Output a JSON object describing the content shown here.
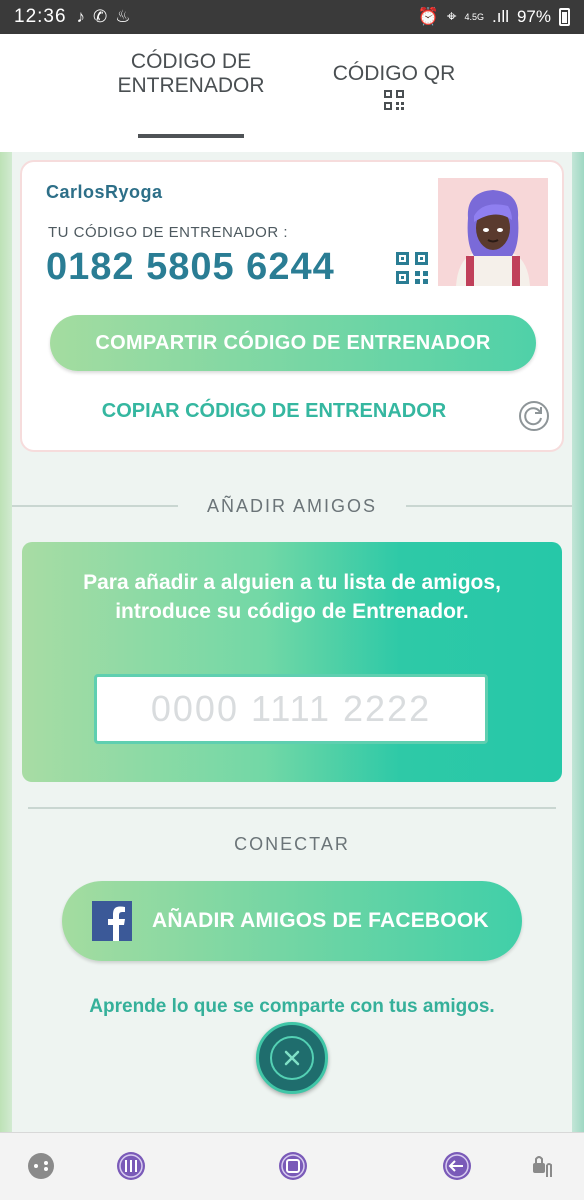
{
  "status_bar": {
    "time": "12:36",
    "network": "4.5G",
    "battery": "97%"
  },
  "tabs": [
    {
      "line1": "CÓDIGO DE",
      "line2": "ENTRENADOR",
      "selected": true
    },
    {
      "line1": "CÓDIGO QR",
      "selected": false
    }
  ],
  "trainer_card": {
    "name": "CarlosRyoga",
    "code_label": "TU CÓDIGO DE ENTRENADOR :",
    "code": "0182 5805 6244",
    "share_button": "COMPARTIR CÓDIGO DE ENTRENADOR",
    "copy_link": "COPIAR CÓDIGO DE ENTRENADOR"
  },
  "add_friends": {
    "section_title": "AÑADIR AMIGOS",
    "instructions": "Para añadir a alguien a tu lista de amigos, introduce su código de Entrenador.",
    "input_placeholder": "0000 1111 2222"
  },
  "connect": {
    "section_title": "CONECTAR",
    "facebook_button": "AÑADIR AMIGOS DE FACEBOOK",
    "learn_link": "Aprende lo que se comparte con tus amigos."
  },
  "colors": {
    "accent_teal": "#2a7d94",
    "button_gradient_start": "#a4dca0",
    "button_gradient_end": "#4fd1a8",
    "facebook_blue": "#3b5998"
  }
}
